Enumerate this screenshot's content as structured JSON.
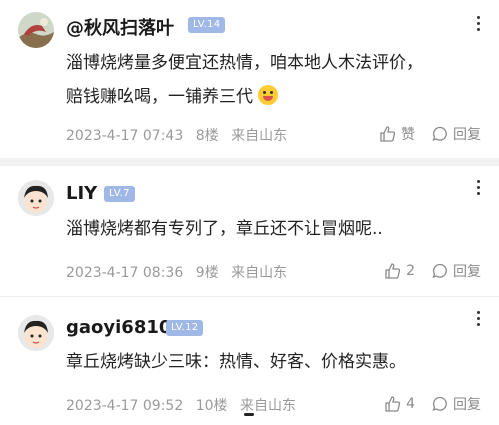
{
  "comments": [
    {
      "username": "@秋风扫落叶",
      "level": "LV.14",
      "text_line1": "淄博烧烤量多便宜还热情，咱本地人木法评价，",
      "text_line2": "赔钱赚吆喝，一铺养三代",
      "emoji": "laughing-crying-emoji",
      "timestamp": "2023-4-17 07:43",
      "floor": "8楼",
      "location": "来自山东",
      "like_label": "赞",
      "reply_label": "回复"
    },
    {
      "username": "LIY",
      "level": "LV.7",
      "text": "淄博烧烤都有专列了，章丘还不让冒烟呢..",
      "timestamp": "2023-4-17 08:36",
      "floor": "9楼",
      "location": "来自山东",
      "like_count": "2",
      "reply_label": "回复"
    },
    {
      "username": "gaoyi6810",
      "level": "LV.12",
      "text": "章丘烧烤缺少三味：热情、好客、价格实惠。",
      "timestamp": "2023-4-17 09:52",
      "floor": "10楼",
      "location": "来自山东",
      "like_count": "4",
      "reply_label": "回复"
    }
  ],
  "colors": {
    "level_badge": "#9fb8e6",
    "meta_text": "#9a9a9a",
    "divider": "#f2f2f2"
  }
}
